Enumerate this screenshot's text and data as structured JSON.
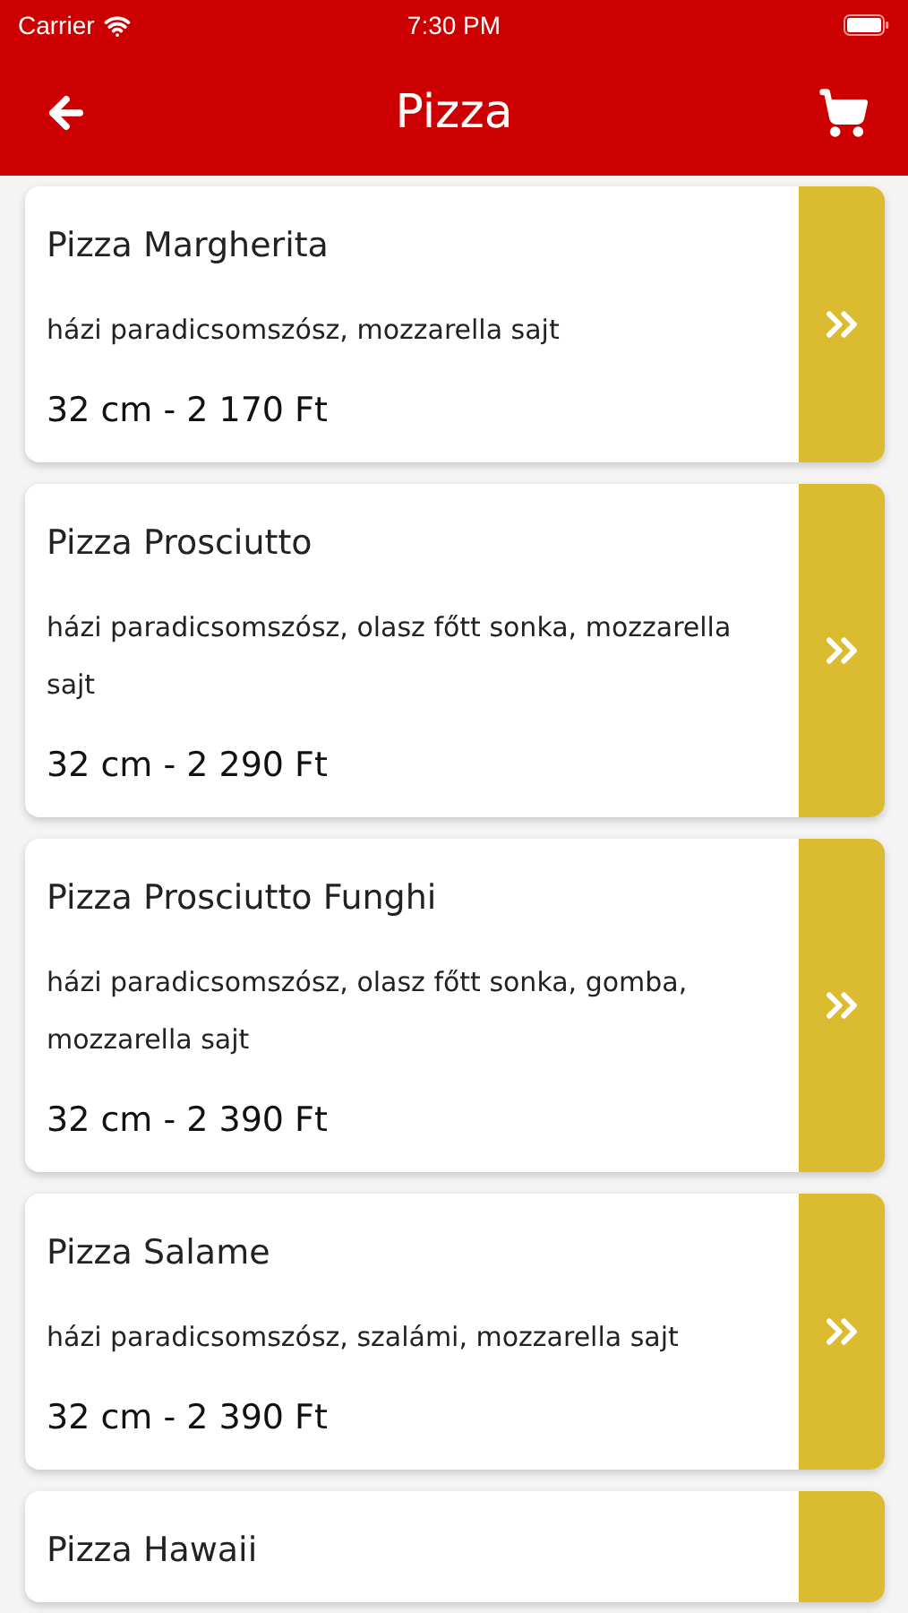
{
  "status_bar": {
    "carrier": "Carrier",
    "time": "7:30 PM"
  },
  "header": {
    "title": "Pizza"
  },
  "items": [
    {
      "name": "Pizza Margherita",
      "description": "házi paradicsomszósz, mozzarella  sajt",
      "price": "32 cm - 2 170 Ft"
    },
    {
      "name": "Pizza Prosciutto",
      "description": "házi paradicsomszósz, olasz főtt sonka, mozzarella sajt",
      "price": "32 cm - 2 290 Ft"
    },
    {
      "name": "Pizza Prosciutto Funghi",
      "description": "házi paradicsomszósz, olasz főtt sonka, gomba, mozzarella  sajt",
      "price": "32 cm - 2 390 Ft"
    },
    {
      "name": "Pizza Salame",
      "description": "házi paradicsomszósz, szalámi, mozzarella  sajt",
      "price": "32 cm - 2 390 Ft"
    },
    {
      "name": "Pizza Hawaii"
    }
  ]
}
